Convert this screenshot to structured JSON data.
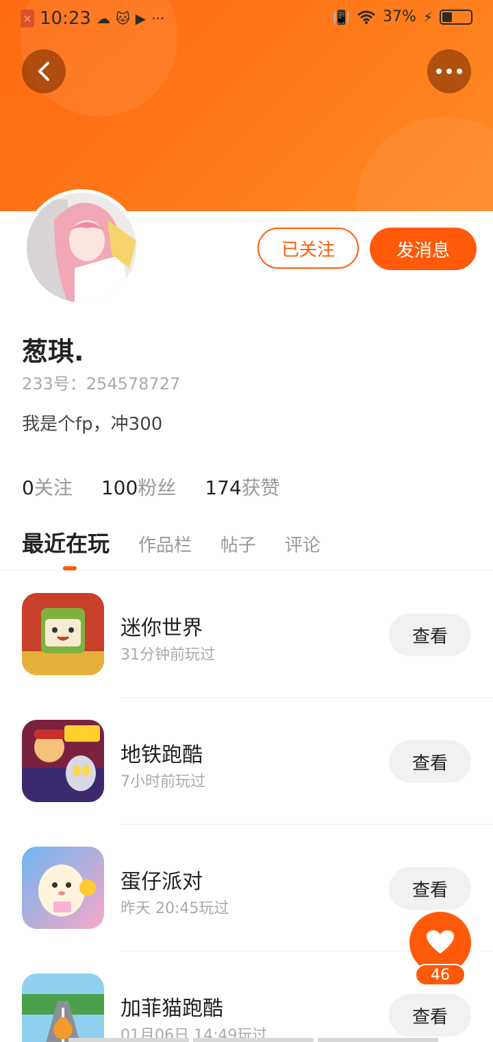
{
  "status_bar": {
    "time": "10:23",
    "battery": "37%",
    "icons": [
      "close-box-icon",
      "cloud-icon",
      "cat-icon",
      "video-icon",
      "ellipsis-icon",
      "vibrate-icon",
      "wifi-icon",
      "charging-icon",
      "battery-icon"
    ]
  },
  "header": {
    "back_icon": "back-arrow-icon",
    "more_icon": "more-dots-icon"
  },
  "profile": {
    "follow_label": "已关注",
    "message_label": "发消息",
    "name": "葱琪.",
    "id_text": "233号：254578727",
    "bio": "我是个fp，冲300"
  },
  "stats": [
    {
      "num": "0",
      "label": "关注"
    },
    {
      "num": "100",
      "label": "粉丝"
    },
    {
      "num": "174",
      "label": "获赞"
    }
  ],
  "tabs": [
    "最近在玩",
    "作品栏",
    "帖子",
    "评论"
  ],
  "games": [
    {
      "name": "迷你世界",
      "time": "31分钟前玩过",
      "button": "查看"
    },
    {
      "name": "地铁跑酷",
      "time": "7小时前玩过",
      "button": "查看"
    },
    {
      "name": "蛋仔派对",
      "time": "昨天 20:45玩过",
      "button": "查看"
    },
    {
      "name": "加菲猫跑酷",
      "time": "01月06日 14:49玩过",
      "button": "查看"
    }
  ],
  "like": {
    "count": "46",
    "icon": "heart-icon"
  },
  "colors": {
    "accent": "#ff5a0a",
    "header": "#ff7a1a"
  }
}
